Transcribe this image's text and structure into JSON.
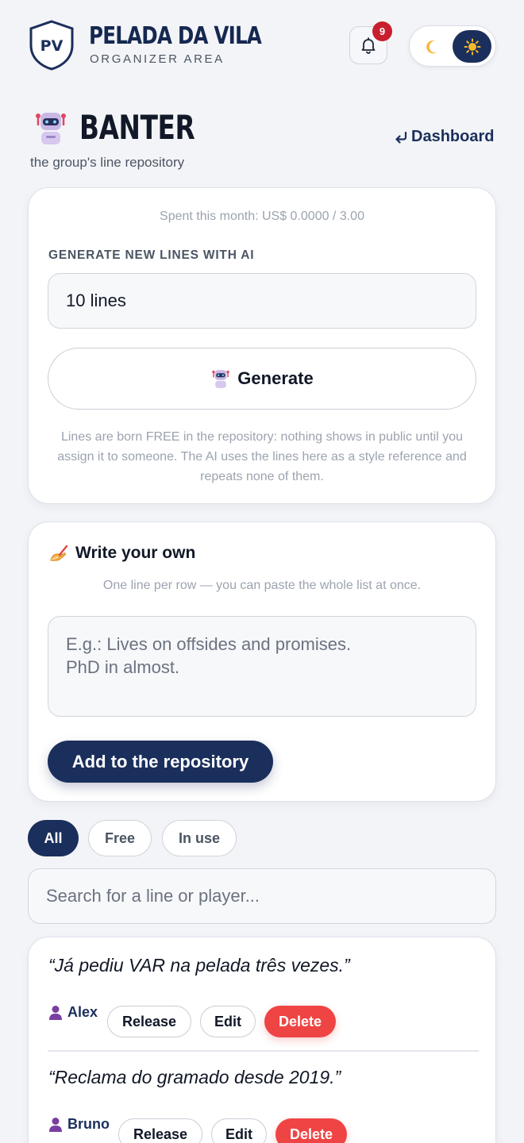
{
  "header": {
    "logo_initials": "PV",
    "brand_title": "PELADA DA VILA",
    "brand_subtitle": "ORGANIZER AREA",
    "notification_count": "9",
    "theme_moon_icon": "moon-icon",
    "theme_sun_icon": "sun-icon"
  },
  "page": {
    "title": "BANTER",
    "subtitle": "the group's line repository",
    "dashboard_link": "Dashboard"
  },
  "ai_card": {
    "spent": "Spent this month: US$ 0.0000 / 3.00",
    "section_label": "GENERATE NEW LINES WITH AI",
    "count_value": "10 lines",
    "generate_label": "Generate",
    "note": "Lines are born FREE in the repository: nothing shows in public until you assign it to someone. The AI uses the lines here as a style reference and repeats none of them."
  },
  "own_card": {
    "title": "Write your own",
    "hint": "One line per row — you can paste the whole list at once.",
    "placeholder": "E.g.: Lives on offsides and promises.\nPhD in almost.",
    "add_label": "Add to the repository"
  },
  "filters": [
    {
      "label": "All",
      "active": true
    },
    {
      "label": "Free",
      "active": false
    },
    {
      "label": "In use",
      "active": false
    }
  ],
  "search": {
    "placeholder": "Search for a line or player..."
  },
  "lines": [
    {
      "text": "“Já pediu VAR na pelada três vezes.”",
      "player": "Alex",
      "release": "Release",
      "edit": "Edit",
      "delete": "Delete"
    },
    {
      "text": "“Reclama do gramado desde 2019.”",
      "player": "Bruno",
      "release": "Release",
      "edit": "Edit",
      "delete": "Delete"
    }
  ],
  "colors": {
    "navy": "#1b2f5c",
    "delete_red": "#ef4444",
    "badge_red": "#c81e2e",
    "background": "#f3f4f8"
  }
}
